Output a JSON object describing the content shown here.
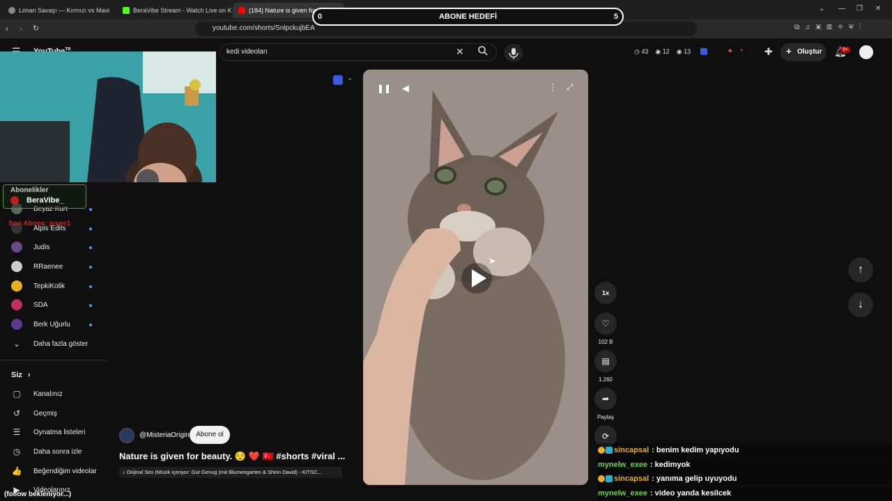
{
  "browser": {
    "tabs": [
      {
        "title": "Liman Savaşı — Kırmızı vs Mavi"
      },
      {
        "title": "BeraVibe Stream - Watch Live on Kick"
      },
      {
        "title": "(184) Nature is given for be..."
      }
    ],
    "url": "youtube.com/shorts/SnlpckujbEA"
  },
  "overlay": {
    "goal_label": "ABONE HEDEFİ",
    "goal_min": "0",
    "goal_max": "5",
    "streamer_label": "Abonelikler",
    "streamer_name": "BeraVibe_",
    "last_sub": "Son Abone: jesee1",
    "follow_wait": "(follow bekleniyor...)"
  },
  "youtube": {
    "logo": "YouTube",
    "logo_sup": "TR",
    "search_value": "kedi videoları",
    "stats": {
      "a": "43",
      "b": "12",
      "c": "13"
    },
    "create_label": "Oluştur",
    "notif_count": "9+"
  },
  "sidebar": {
    "subscriptions": [
      {
        "name": "Beyaz Kurt",
        "color": "#5a6a5a"
      },
      {
        "name": "Alpis Edits",
        "color": "#333333"
      },
      {
        "name": "Judis",
        "color": "#6a4a8a"
      },
      {
        "name": "RRaenee",
        "color": "#cccccc"
      },
      {
        "name": "TepkiKolik",
        "color": "#e8b020"
      },
      {
        "name": "SDA",
        "color": "#c0305a"
      },
      {
        "name": "Berk Uğurlu",
        "color": "#5a3a8a"
      }
    ],
    "show_more": "Daha fazla göster",
    "you_section": "Siz",
    "you_items": [
      {
        "name": "Kanalınız",
        "icon": "channel-icon",
        "glyph": "▢"
      },
      {
        "name": "Geçmiş",
        "icon": "history-icon",
        "glyph": "↺"
      },
      {
        "name": "Oynatma listeleri",
        "icon": "playlist-icon",
        "glyph": "☰"
      },
      {
        "name": "Daha sonra izle",
        "icon": "clock-icon",
        "glyph": "◷"
      },
      {
        "name": "Beğendiğim videolar",
        "icon": "thumb-up-icon",
        "glyph": "👍"
      },
      {
        "name": "Videolarınız",
        "icon": "video-icon",
        "glyph": "▶"
      }
    ]
  },
  "short": {
    "channel": "@MisteriaOrigin",
    "subscribe": "Abone ol",
    "title": "Nature is given for beauty. 😌 ❤️ 🇹🇷 #shorts #viral ...",
    "music": "♪ Orijinal Ses (Müzik içeriyor: Gut Genug (mit Blumengarten & Shirin David) - KITSC..."
  },
  "actions": {
    "speed": "1x",
    "likes": "102 B",
    "comments": "1.260",
    "share": "Paylaş",
    "remix": "Remix"
  },
  "chat": [
    {
      "user": "sincapsal",
      "color": "#e8b030",
      "text": ": benim kedim yapıyodu",
      "badges": true
    },
    {
      "user": "mynelw_exee",
      "color": "#6bd24a",
      "text": ": kedimyok",
      "badges": false
    },
    {
      "user": "sincapsal",
      "color": "#e8b030",
      "text": ": yanıma gelip uyuyodu",
      "badges": true
    },
    {
      "user": "mynelw_exee",
      "color": "#6bd24a",
      "text": ": video yanda kesilcek",
      "badges": false
    }
  ]
}
